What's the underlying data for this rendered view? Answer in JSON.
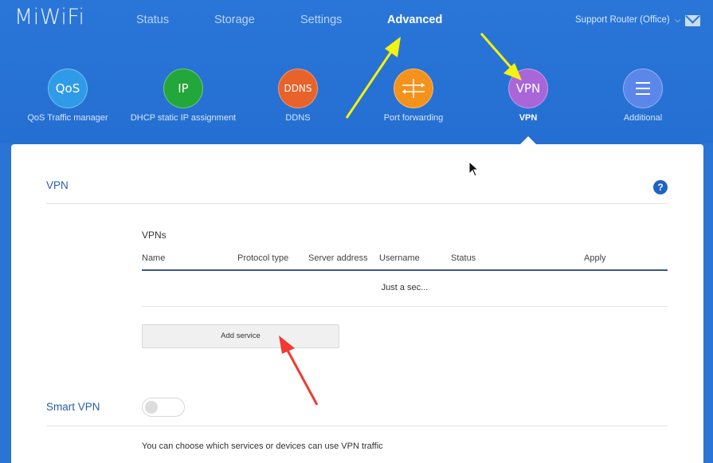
{
  "header": {
    "logo": "MiWiFi",
    "nav": [
      {
        "label": "Status"
      },
      {
        "label": "Storage"
      },
      {
        "label": "Settings"
      },
      {
        "label": "Advanced",
        "active": true
      }
    ],
    "router_name": "Support Router (Office)",
    "icons": {
      "dropdown": "chevron-down-icon",
      "mail": "mail-icon"
    }
  },
  "tiles": [
    {
      "icon_text": "QoS",
      "label": "QoS Traffic manager",
      "color": "#2f9be8"
    },
    {
      "icon_text": "IP",
      "label": "DHCP static IP assignment",
      "color": "#23a63a"
    },
    {
      "icon_text": "DDNS",
      "label": "DDNS",
      "color": "#e8632a"
    },
    {
      "icon_text": "",
      "label": "Port forwarding",
      "color": "#f5921c"
    },
    {
      "icon_text": "VPN",
      "label": "VPN",
      "color": "#a866d9",
      "active": true
    },
    {
      "icon_text": "",
      "label": "Additional",
      "color": "#5b86ea"
    }
  ],
  "vpn": {
    "section_title": "VPN",
    "help": "?",
    "table_title": "VPNs",
    "columns": [
      "Name",
      "Protocol type",
      "Server address",
      "Username",
      "Status",
      "Apply"
    ],
    "loading_text": "Just a sec...",
    "add_button": "Add service"
  },
  "smart_vpn": {
    "title": "Smart VPN",
    "enabled": false,
    "description": "You can choose which services or devices can use VPN traffic"
  },
  "colors": {
    "header_bg": "#2a74d6",
    "accent_title": "#2a5ea9",
    "annotation_yellow": "#f4f20e",
    "annotation_red": "#f03a32"
  }
}
